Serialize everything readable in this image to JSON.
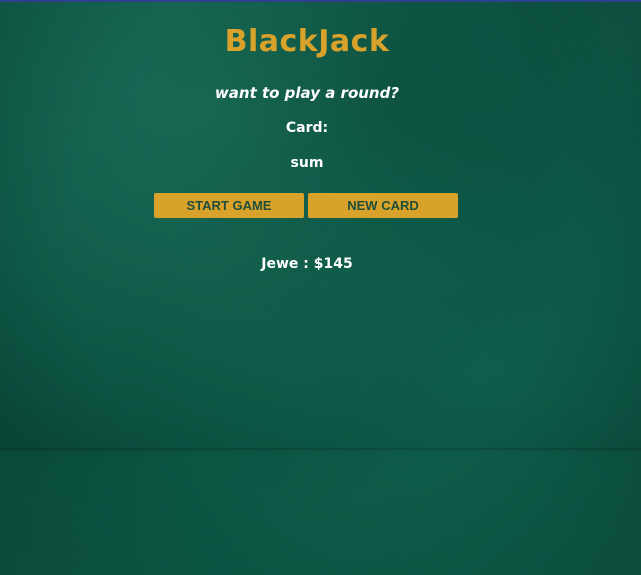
{
  "game": {
    "title": "BlackJack",
    "message": "want to play a round?",
    "cards_label": "Card:",
    "sum_label": "sum",
    "start_button_label": "START GAME",
    "new_card_button_label": "NEW CARD",
    "player_info": "Jewe : $145"
  },
  "colors": {
    "accent": "#d9a22a",
    "felt": "#0c5444",
    "button_text": "#1e4e3a",
    "text": "#ffffff"
  }
}
